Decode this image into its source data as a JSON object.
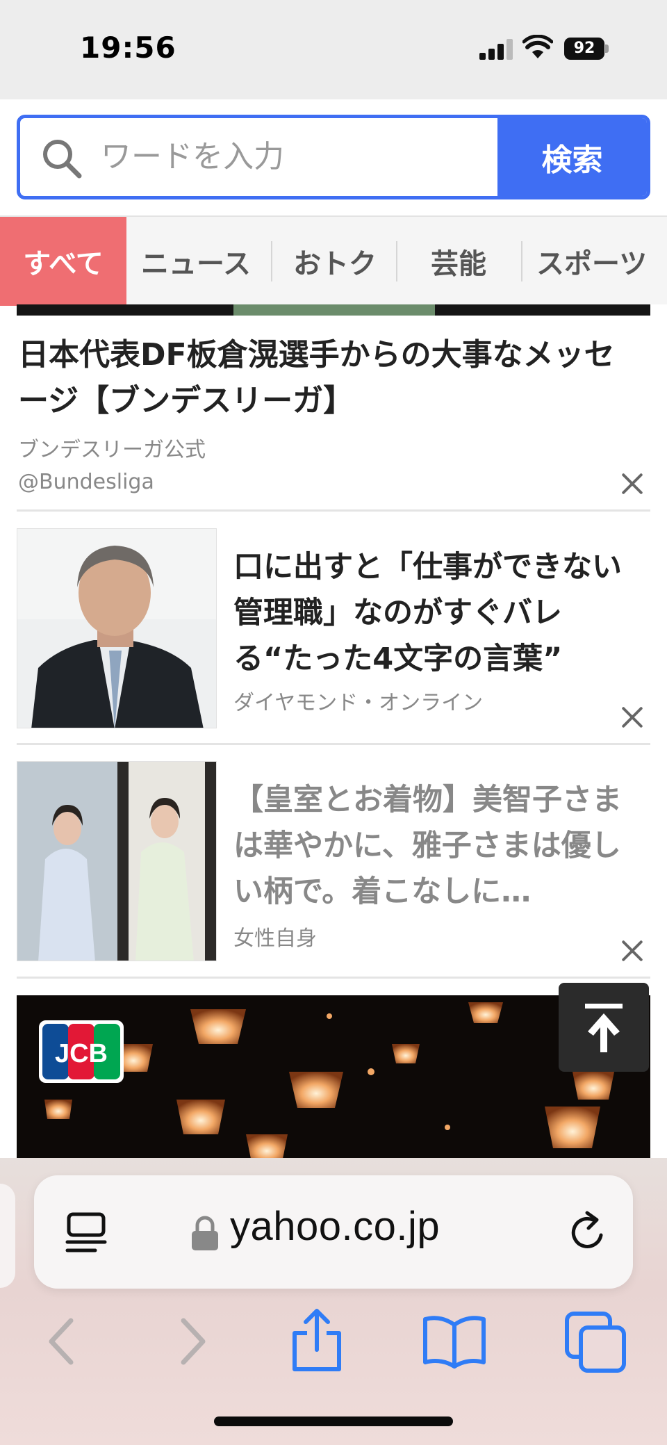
{
  "status_bar": {
    "time": "19:56",
    "battery": "92"
  },
  "search": {
    "placeholder": "ワードを入力",
    "button_label": "検索"
  },
  "tabs": [
    {
      "label": "すべて",
      "active": true
    },
    {
      "label": "ニュース",
      "active": false
    },
    {
      "label": "おトク",
      "active": false
    },
    {
      "label": "芸能",
      "active": false
    },
    {
      "label": "スポーツ",
      "active": false
    }
  ],
  "ad": {
    "title": "日本代表DF板倉滉選手からの大事なメッセージ【ブンデスリーガ】",
    "source": "ブンデスリーガ公式",
    "handle": "@Bundesliga"
  },
  "articles": [
    {
      "title": "口に出すと「仕事ができない管理職」なのがすぐバレる“たった4文字の言葉”",
      "source": "ダイヤモンド・オンライン",
      "read": false
    },
    {
      "title": "【皇室とお着物】美智子さまは華やかに、雅子さまは優しい柄で。着こなしに…",
      "source": "女性自身",
      "read": true
    }
  ],
  "jcb_ad": {
    "logo_text": "JCB"
  },
  "browser": {
    "url": "yahoo.co.jp"
  },
  "colors": {
    "accent_blue": "#3f6ef3",
    "active_tab": "#ef6e72",
    "ios_blue": "#2f7cf6"
  },
  "icons": [
    "search-icon",
    "close-icon",
    "scroll-to-top-icon",
    "reader-mode-icon",
    "lock-icon",
    "reload-icon",
    "back-icon",
    "forward-icon",
    "share-icon",
    "bookmarks-icon",
    "tabs-icon"
  ]
}
